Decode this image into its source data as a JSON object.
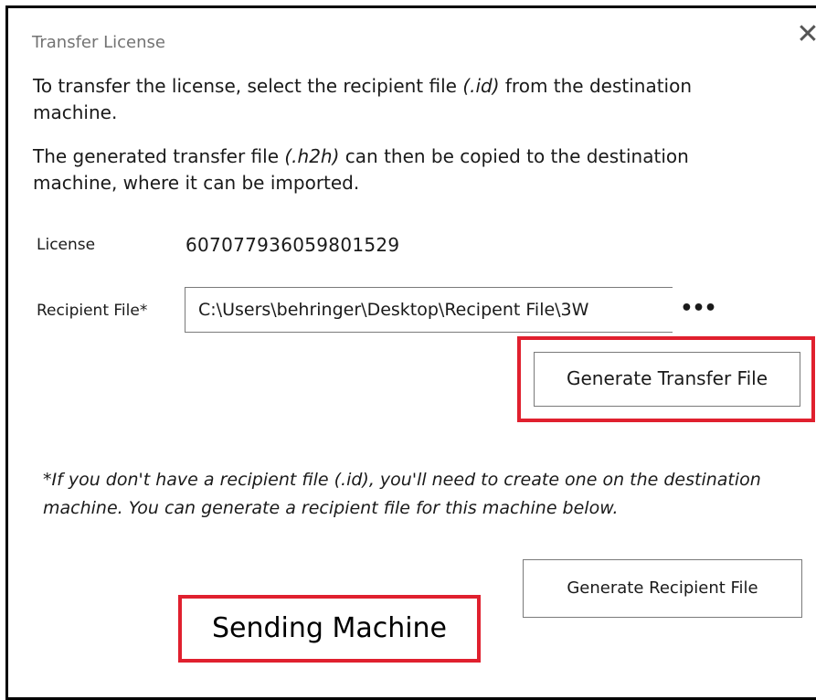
{
  "dialog": {
    "title": "Transfer License",
    "close_glyph": "✕"
  },
  "instructions": {
    "p1_before": "To transfer the license, select the recipient file ",
    "p1_ext": "(.id)",
    "p1_after": " from the destination machine.",
    "p2_before": "The generated transfer file ",
    "p2_ext": "(.h2h)",
    "p2_after": " can then be copied to the destination machine, where it can be imported."
  },
  "license": {
    "label": "License",
    "value": "607077936059801529"
  },
  "recipient": {
    "label": "Recipient File*",
    "value": "C:\\Users\\behringer\\Desktop\\Recipent File\\3W",
    "browse_glyph": "•••"
  },
  "buttons": {
    "generate_transfer": "Generate Transfer File",
    "generate_recipient": "Generate Recipient File"
  },
  "note": {
    "text": "*If you don't have a recipient file (.id), you'll need to create one on the destination machine. You can generate a recipient file for this machine below."
  },
  "annotation": {
    "label": "Sending Machine",
    "highlight_color": "#e0202e"
  },
  "icons": {
    "close": "close-icon",
    "browse": "ellipsis-icon"
  }
}
